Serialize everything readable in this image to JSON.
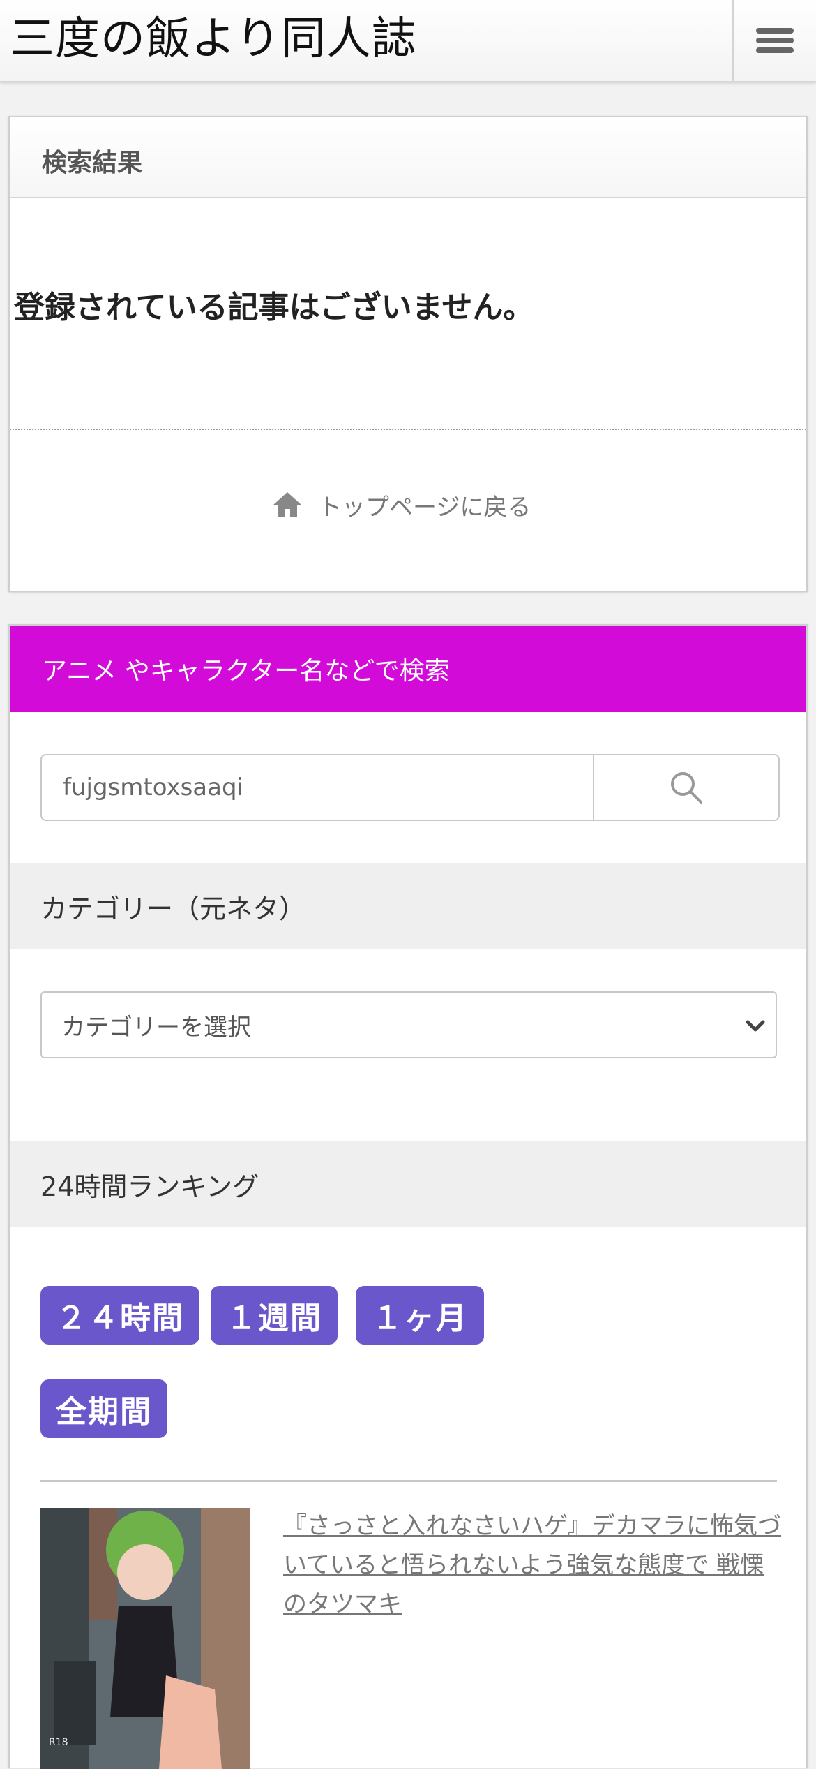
{
  "header": {
    "site_title": "三度の飯より同人誌",
    "menu_icon": "hamburger-menu-icon"
  },
  "search_results": {
    "heading": "検索結果",
    "message": "登録されている記事はございません。",
    "back_link": "トップページに戻る",
    "back_icon": "home-icon"
  },
  "search_widget": {
    "heading": "アニメ やキャラクター名などで検索",
    "input_value": "fujgsmtoxsaaqi",
    "button_icon": "search-icon",
    "accent_color": "#d20bd8"
  },
  "category": {
    "heading": "カテゴリー（元ネタ）",
    "select_value": "カテゴリーを選択"
  },
  "ranking": {
    "heading": "24時間ランキング",
    "tabs": [
      "２４時間",
      "１週間",
      "１ヶ月",
      "全期間"
    ],
    "tab_color": "#6a57cc",
    "items": [
      {
        "title": "『さっさと入れなさいハゲ』デカマラに怖気づいていると悟られないよう強気な態度で 戦慄のタツマキ",
        "thumb_badge": "R18"
      }
    ]
  }
}
